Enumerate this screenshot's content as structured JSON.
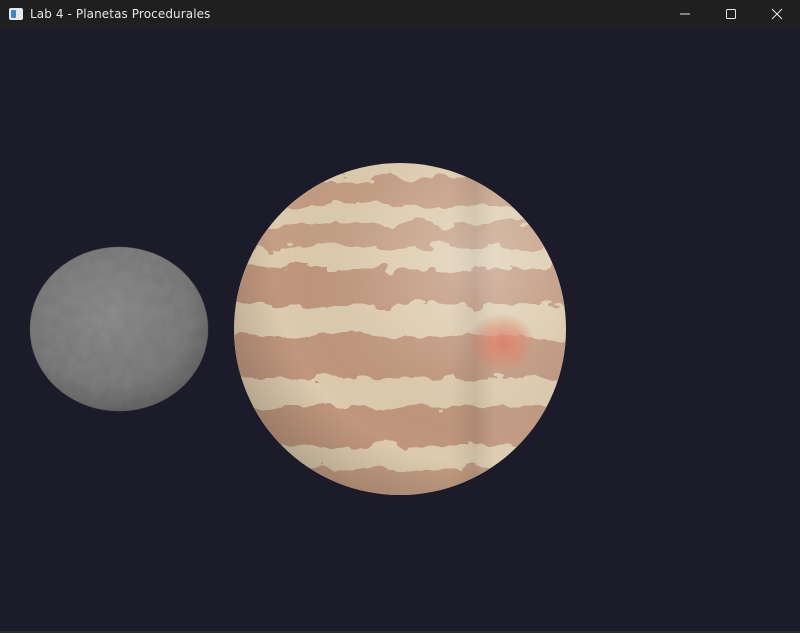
{
  "window": {
    "title": "Lab 4 - Planetas Procedurales",
    "app_icon": "app-window-icon",
    "controls": {
      "minimize_icon": "minimize-icon",
      "maximize_icon": "maximize-icon",
      "close_icon": "close-icon"
    }
  },
  "scene": {
    "background_color": "#1b1b29",
    "planets": [
      {
        "name": "rocky-moon",
        "color": "#8a8a8a"
      },
      {
        "name": "gas-giant",
        "color": "#d9c7a8",
        "band_color": "#c0967c",
        "spot_color": "#d86a50"
      }
    ]
  }
}
